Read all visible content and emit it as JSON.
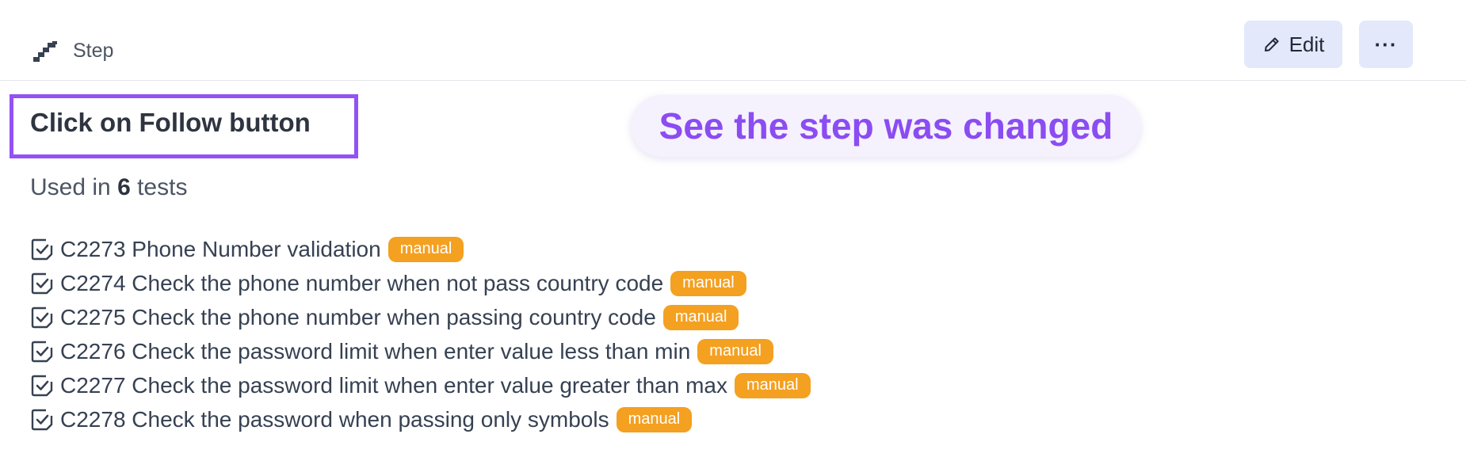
{
  "header": {
    "step_label": "Step",
    "step_icon": "steps-icon",
    "edit_label": "Edit",
    "edit_icon": "pencil-icon",
    "more_label": "···",
    "more_icon": "more-horizontal-icon"
  },
  "step": {
    "title": "Click on Follow button"
  },
  "callout": {
    "text": "See the step was changed"
  },
  "usage": {
    "prefix": "Used in",
    "count": "6",
    "suffix": "tests"
  },
  "tests": [
    {
      "label": "C2273 Phone Number validation",
      "badge": "manual"
    },
    {
      "label": "C2274 Check the phone number when not pass country code",
      "badge": "manual"
    },
    {
      "label": "C2275 Check the phone number when passing country code",
      "badge": "manual"
    },
    {
      "label": "C2276 Check the password limit when enter value less than min",
      "badge": "manual"
    },
    {
      "label": "C2277 Check the password limit when enter value greater than max",
      "badge": "manual"
    },
    {
      "label": "C2278 Check the password when passing only symbols",
      "badge": "manual"
    }
  ],
  "colors": {
    "highlight_border": "#9352f5",
    "callout_text": "#8b4cf2",
    "badge_bg": "#f4a020",
    "button_bg": "#e3e8fb"
  }
}
